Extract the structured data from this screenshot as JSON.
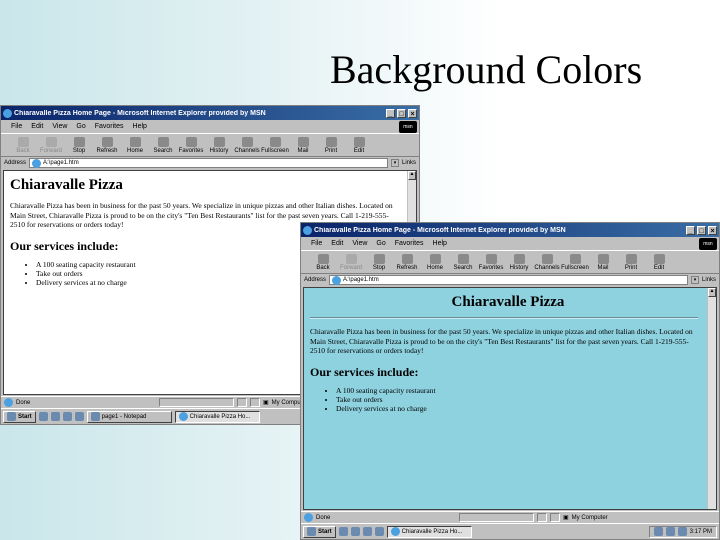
{
  "slide_title": "Background Colors",
  "browser": {
    "window_title": "Chiaravalle Pizza Home Page - Microsoft Internet Explorer provided by MSN",
    "menu": [
      "File",
      "Edit",
      "View",
      "Go",
      "Favorites",
      "Help"
    ],
    "msn_logo": "msn",
    "toolbar": [
      {
        "label": "Back",
        "icon": "back-arrow-icon",
        "disabled_first": true
      },
      {
        "label": "Forward",
        "icon": "forward-arrow-icon"
      },
      {
        "label": "Stop",
        "icon": "stop-icon"
      },
      {
        "label": "Refresh",
        "icon": "refresh-icon"
      },
      {
        "label": "Home",
        "icon": "home-icon"
      },
      {
        "label": "Search",
        "icon": "search-icon"
      },
      {
        "label": "Favorites",
        "icon": "favorites-icon"
      },
      {
        "label": "History",
        "icon": "history-icon"
      },
      {
        "label": "Channels",
        "icon": "channels-icon"
      },
      {
        "label": "Fullscreen",
        "icon": "fullscreen-icon"
      },
      {
        "label": "Mail",
        "icon": "mail-icon"
      },
      {
        "label": "Print",
        "icon": "print-icon"
      },
      {
        "label": "Edit",
        "icon": "edit-icon"
      }
    ],
    "address_label": "Address",
    "address_value": "A:\\page1.htm",
    "links_label": "Links",
    "status_text": "Done",
    "status_zone": "My Computer"
  },
  "page": {
    "heading": "Chiaravalle Pizza",
    "paragraph": "Chiaravalle Pizza has been in business for the past 50 years. We specialize in unique pizzas and other Italian dishes. Located on Main Street, Chiaravalle Pizza is proud to be on the city's \"Ten Best Restaurants\" list for the past seven years. Call 1-219-555-2510 for reservations or orders today!",
    "subheading": "Our services include:",
    "services": [
      "A 100 seating capacity restaurant",
      "Take out orders",
      "Delivery services at no charge"
    ]
  },
  "window1": {
    "background_color": "#ffffff",
    "back_disabled": true
  },
  "window2": {
    "background_color": "#8ed1df",
    "back_disabled": false
  },
  "taskbar": {
    "start_label": "Start",
    "task_notepad": "page1 - Notepad",
    "task_ie": "Chiaravalle Pizza Ho...",
    "clock": "3:17 PM"
  }
}
